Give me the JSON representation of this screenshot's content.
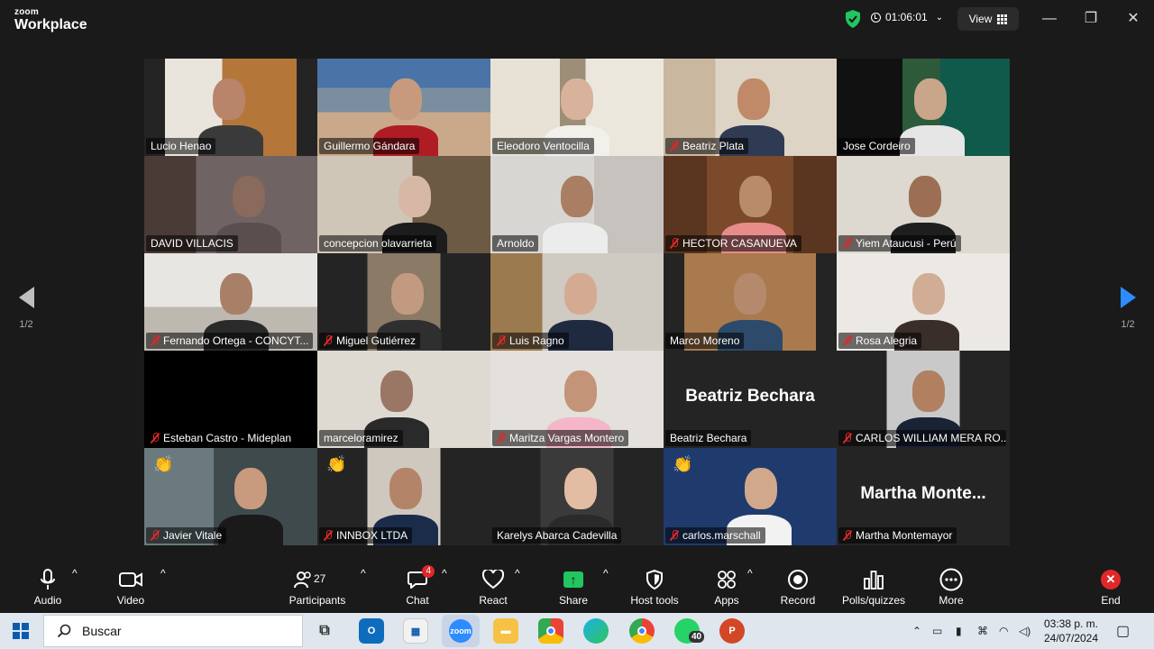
{
  "app": {
    "brand_small": "zoom",
    "brand_big": "Workplace"
  },
  "header": {
    "timer": "01:06:01",
    "view_label": "View"
  },
  "pagination": {
    "left_page": "1/2",
    "right_page": "1/2"
  },
  "participants": [
    {
      "name": "Lucio Henao",
      "muted": false,
      "hand": false
    },
    {
      "name": "Guillermo Gándara",
      "muted": false,
      "hand": false
    },
    {
      "name": "Eleodoro Ventocilla",
      "muted": false,
      "hand": false
    },
    {
      "name": "Beatriz Plata",
      "muted": true,
      "hand": false
    },
    {
      "name": "Jose Cordeiro",
      "muted": false,
      "hand": false,
      "active": true
    },
    {
      "name": "DAVID VILLACIS",
      "muted": false,
      "hand": false
    },
    {
      "name": "concepcion olavarrieta",
      "muted": false,
      "hand": false
    },
    {
      "name": "Arnoldo",
      "muted": false,
      "hand": false
    },
    {
      "name": "HECTOR CASANUEVA",
      "muted": true,
      "hand": false
    },
    {
      "name": "Yiem Ataucusi - Perú",
      "muted": true,
      "hand": false
    },
    {
      "name": "Fernando Ortega - CONCYT...",
      "muted": true,
      "hand": false
    },
    {
      "name": "Miguel Gutiérrez",
      "muted": true,
      "hand": false
    },
    {
      "name": "Luis Ragno",
      "muted": true,
      "hand": false
    },
    {
      "name": "Marco Moreno",
      "muted": false,
      "hand": false
    },
    {
      "name": "Rosa Alegria",
      "muted": true,
      "hand": false
    },
    {
      "name": "Esteban Castro - Mideplan",
      "muted": true,
      "hand": false
    },
    {
      "name": "marceloramirez",
      "muted": false,
      "hand": false
    },
    {
      "name": "Maritza Vargas Montero",
      "muted": true,
      "hand": false
    },
    {
      "name": "Beatriz Bechara",
      "muted": false,
      "hand": false,
      "big_label": "Beatriz Bechara"
    },
    {
      "name": "CARLOS WILLIAM MERA RO...",
      "muted": true,
      "hand": false
    },
    {
      "name": "Javier Vitale",
      "muted": true,
      "hand": true
    },
    {
      "name": "INNBOX LTDA",
      "muted": true,
      "hand": true
    },
    {
      "name": "Karelys Abarca Cadevilla",
      "muted": false,
      "hand": false
    },
    {
      "name": "carlos.marschall",
      "muted": true,
      "hand": true
    },
    {
      "name": "Martha Montemayor",
      "muted": true,
      "hand": false,
      "big_label": "Martha  Monte..."
    }
  ],
  "toolbar": {
    "audio": "Audio",
    "video": "Video",
    "participants": "Participants",
    "participants_count": "27",
    "chat": "Chat",
    "chat_badge": "4",
    "react": "React",
    "share": "Share",
    "host_tools": "Host tools",
    "apps": "Apps",
    "record": "Record",
    "polls": "Polls/quizzes",
    "more": "More",
    "end": "End"
  },
  "taskbar": {
    "search_placeholder": "Buscar",
    "zoom_label": "zoom",
    "whatsapp_badge": "40",
    "time": "03:38 p. m.",
    "date": "24/07/2024"
  },
  "colors": {
    "active_speaker": "#2ee86a",
    "share_green": "#22c55e",
    "end_red": "#e02828",
    "accent_blue": "#2d8cff"
  }
}
